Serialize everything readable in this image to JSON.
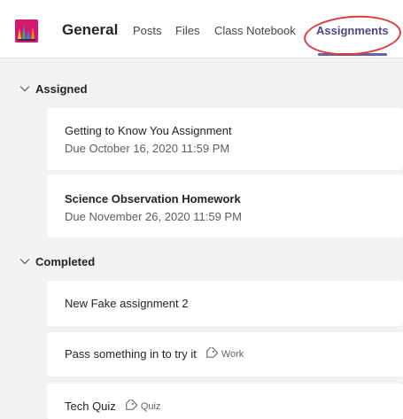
{
  "header": {
    "team_name": "General",
    "tabs": [
      {
        "label": "Posts"
      },
      {
        "label": "Files"
      },
      {
        "label": "Class Notebook"
      },
      {
        "label": "Assignments"
      }
    ],
    "active_tab": "Assignments"
  },
  "sections": {
    "assigned": {
      "label": "Assigned",
      "items": [
        {
          "title": "Getting to Know You Assignment",
          "due": "Due October 16, 2020 11:59 PM"
        },
        {
          "title": "Science Observation Homework",
          "due": "Due November 26, 2020 11:59 PM"
        }
      ]
    },
    "completed": {
      "label": "Completed",
      "items": [
        {
          "title": "New Fake assignment 2"
        },
        {
          "title": "Pass something in to try it",
          "tag": "Work"
        },
        {
          "title": "Tech Quiz",
          "tag": "Quiz"
        }
      ]
    }
  },
  "colors": {
    "accent": "#6264a7",
    "annotation": "#e03b3b",
    "background": "#f3f2f1"
  }
}
